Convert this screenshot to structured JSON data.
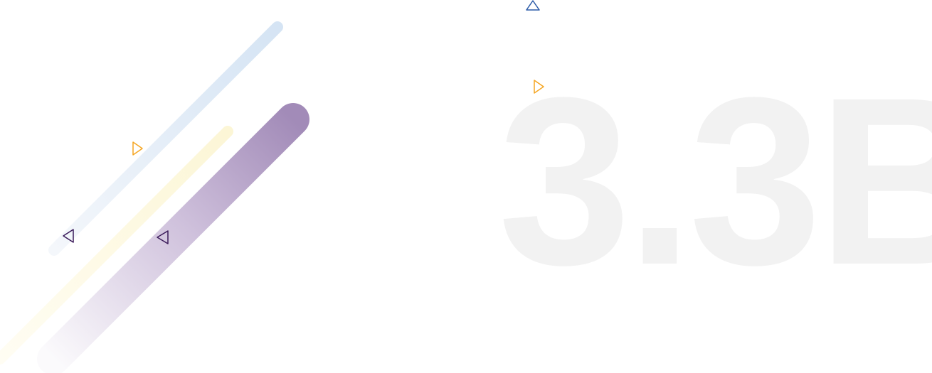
{
  "hero": {
    "big_stat": "3.3B",
    "big_stat_color": "#f2f2f2"
  },
  "colors": {
    "stripe_blue": "#dce8f5",
    "stripe_yellow": "#fdf9e1",
    "stripe_purple": "#a28bb8",
    "accent_orange": "#f5a623",
    "accent_purple": "#3b1a5a",
    "accent_blue": "#2a5aa8"
  },
  "icons": [
    "triangle-up-outline-icon",
    "triangle-right-outline-icon",
    "triangle-left-outline-icon"
  ]
}
